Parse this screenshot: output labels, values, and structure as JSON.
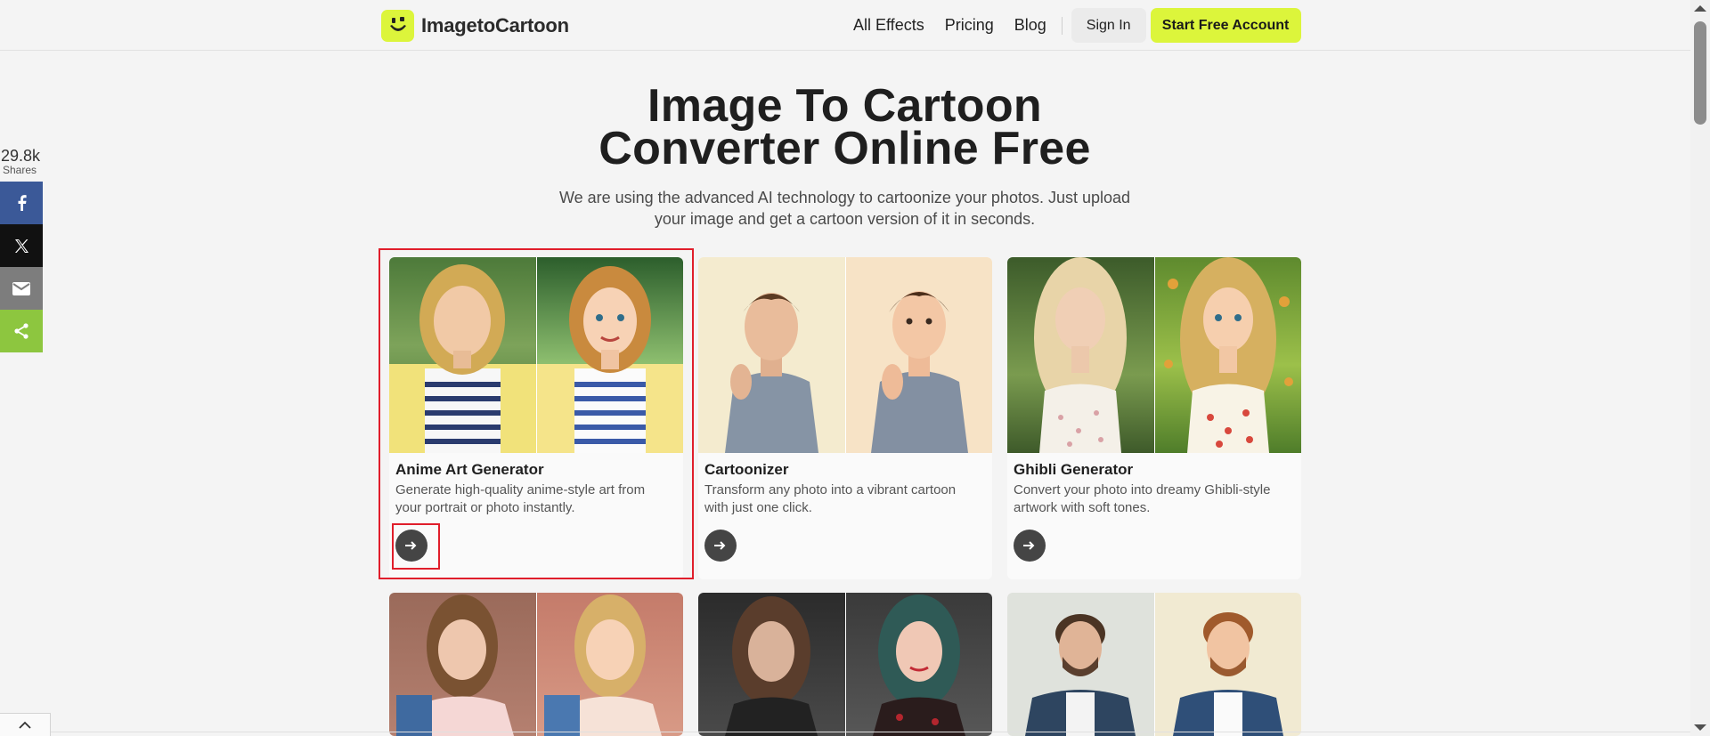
{
  "header": {
    "logo_text": "ImagetoCartoon",
    "nav": [
      "All Effects",
      "Pricing",
      "Blog"
    ],
    "sign_in": "Sign In",
    "start_free": "Start Free Account"
  },
  "share": {
    "count": "29.8k",
    "label": "Shares",
    "buttons": [
      "facebook",
      "x",
      "email",
      "share"
    ]
  },
  "hero": {
    "title_line1": "Image To Cartoon",
    "title_line2": "Converter Online Free",
    "subtitle": "We are using the advanced AI technology to cartoonize your photos. Just upload your image and get a cartoon version of it in seconds."
  },
  "cards": [
    {
      "title": "Anime Art Generator",
      "desc": "Generate high-quality anime-style art from your portrait or photo instantly."
    },
    {
      "title": "Cartoonizer",
      "desc": "Transform any photo into a vibrant cartoon with just one click."
    },
    {
      "title": "Ghibli Generator",
      "desc": "Convert your photo into dreamy Ghibli-style artwork with soft tones."
    }
  ],
  "colors": {
    "accent": "#dcf53b",
    "highlight": "#e01e2b",
    "facebook": "#3b5998",
    "x": "#111111",
    "email": "#7d7d7d",
    "share": "#8dc63f"
  }
}
